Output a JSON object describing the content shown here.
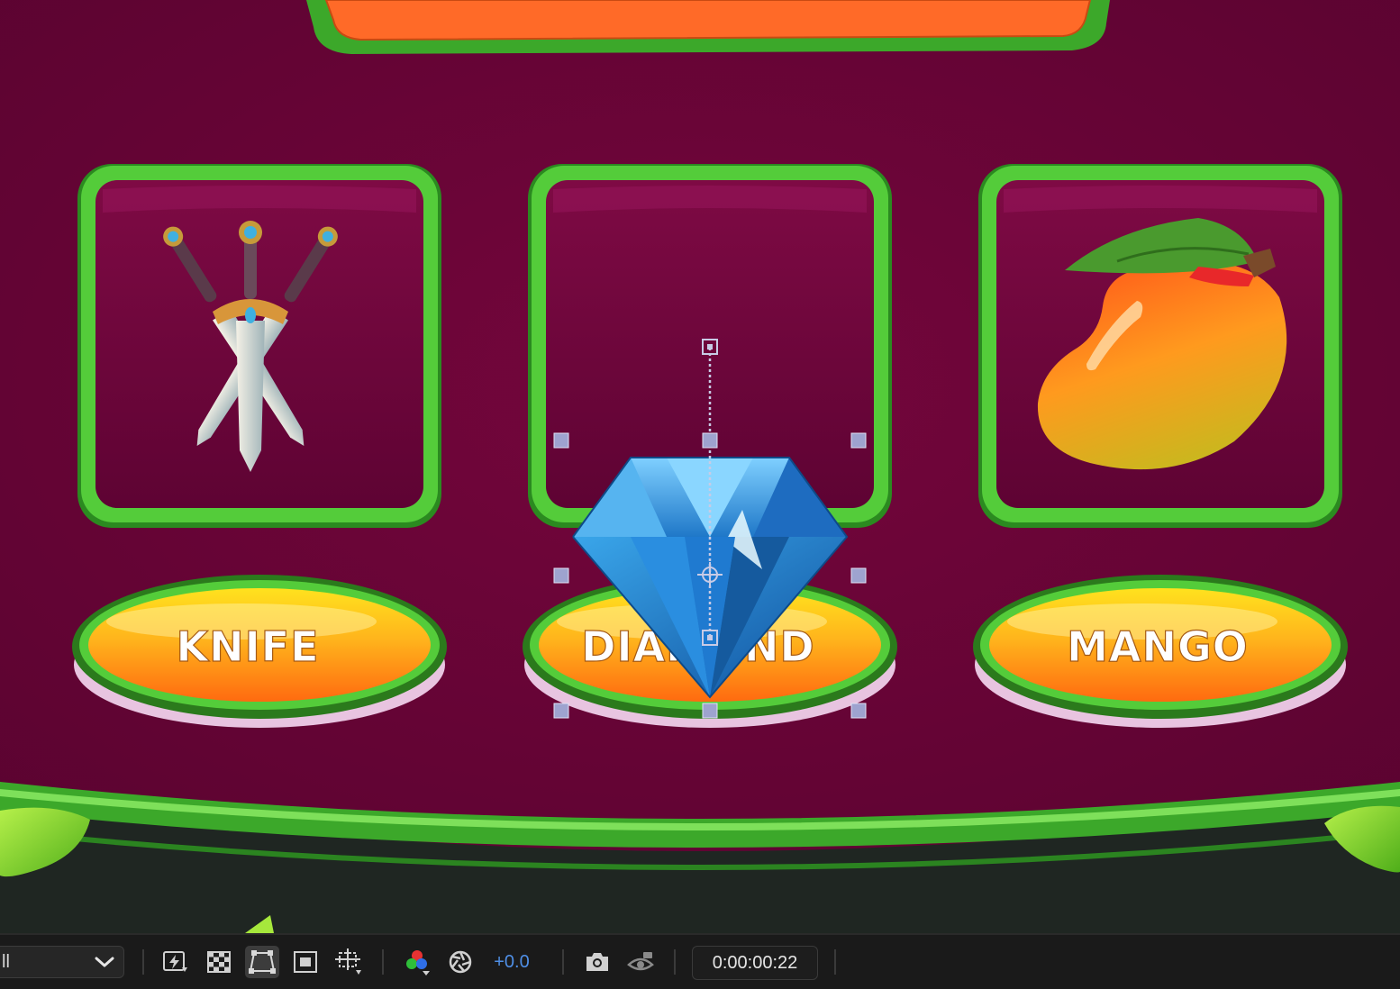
{
  "composition": {
    "slots": [
      {
        "item": "knife",
        "label": "KNIFE",
        "icon": "crossed-daggers-icon"
      },
      {
        "item": "diamond",
        "label": "DIAMOND",
        "icon": "diamond-icon"
      },
      {
        "item": "mango",
        "label": "MANGO",
        "icon": "mango-icon"
      }
    ],
    "selected_layer": "diamond",
    "colors": {
      "background": "#6a0535",
      "frame_green": "#4fcc3c",
      "label_orange": "#ff8c1a",
      "label_yellow": "#ffd21a",
      "diamond_blue": "#2f8fd8"
    }
  },
  "toolbar": {
    "resolution_value": "ll",
    "buttons": [
      {
        "name": "fast-previews-button",
        "icon": "fast-previews-icon"
      },
      {
        "name": "transparency-grid-button",
        "icon": "transparency-grid-icon"
      },
      {
        "name": "mask-path-visibility-button",
        "icon": "mask-visibility-icon",
        "active": true
      },
      {
        "name": "region-of-interest-button",
        "icon": "region-of-interest-icon"
      },
      {
        "name": "grid-guides-button",
        "icon": "grid-guides-icon"
      },
      {
        "name": "show-channel-button",
        "icon": "rgb-channel-icon"
      },
      {
        "name": "reset-exposure-button",
        "icon": "exposure-icon"
      },
      {
        "name": "snapshot-button",
        "icon": "camera-icon"
      },
      {
        "name": "show-snapshot-button",
        "icon": "show-snapshot-icon"
      }
    ],
    "exposure": "+0.0",
    "timecode": "0:00:00:22"
  }
}
